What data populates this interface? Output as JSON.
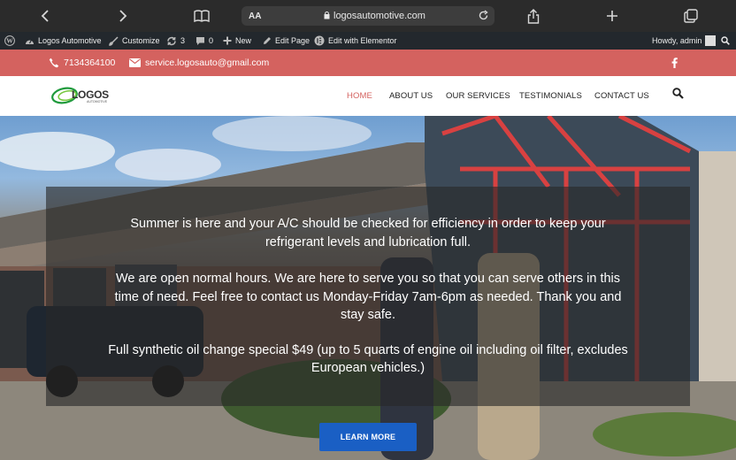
{
  "browser": {
    "text_size_label": "AA",
    "url": "logosautomotive.com"
  },
  "admin_bar": {
    "site_name": "Logos Automotive",
    "customize": "Customize",
    "updates_count": "3",
    "comments_count": "0",
    "new_label": "New",
    "edit_page": "Edit Page",
    "edit_elementor": "Edit with Elementor",
    "howdy": "Howdy, admin"
  },
  "top_bar": {
    "phone": "7134364100",
    "email": "service.logosauto@gmail.com",
    "social_icon": "facebook-icon"
  },
  "header": {
    "logo_text": "LOGOS",
    "logo_sub": "AUTOMOTIVE",
    "nav": [
      "HOME",
      "ABOUT US",
      "OUR SERVICES",
      "TESTIMONIALS",
      "CONTACT US"
    ],
    "active_color": "#d4625f"
  },
  "hero": {
    "line1": "Summer is here and your A/C should be checked for efficiency in order to keep your",
    "line2": "refrigerant levels and lubrication full.",
    "line3": "We are open normal hours. We are here to serve you so that you can serve others in this",
    "line4": "time of need. Feel free to contact us Monday-Friday 7am-6pm as needed. Thank you and",
    "line5": "stay safe.",
    "line6": "Full synthetic oil change special $49 (up to 5 quarts of engine oil including oil filter, excludes",
    "line7": "European vehicles.)",
    "button": "LEARN MORE",
    "button_color": "#1a5fc4"
  }
}
